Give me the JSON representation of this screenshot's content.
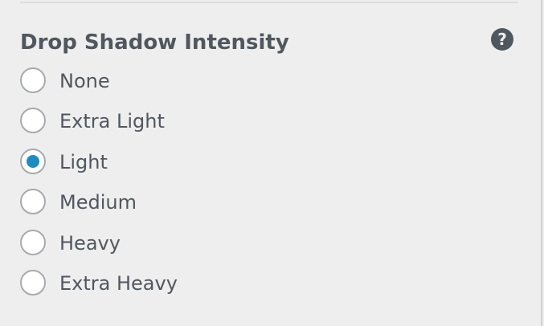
{
  "section": {
    "title": "Drop Shadow Intensity",
    "help_icon_glyph": "?"
  },
  "options": [
    {
      "label": "None",
      "checked": false
    },
    {
      "label": "Extra Light",
      "checked": false
    },
    {
      "label": "Light",
      "checked": true
    },
    {
      "label": "Medium",
      "checked": false
    },
    {
      "label": "Heavy",
      "checked": false
    },
    {
      "label": "Extra Heavy",
      "checked": false
    }
  ],
  "colors": {
    "accent": "#1e8cbe",
    "text": "#50575e",
    "background": "#eeeeee",
    "radio_border": "#a7aaad"
  }
}
